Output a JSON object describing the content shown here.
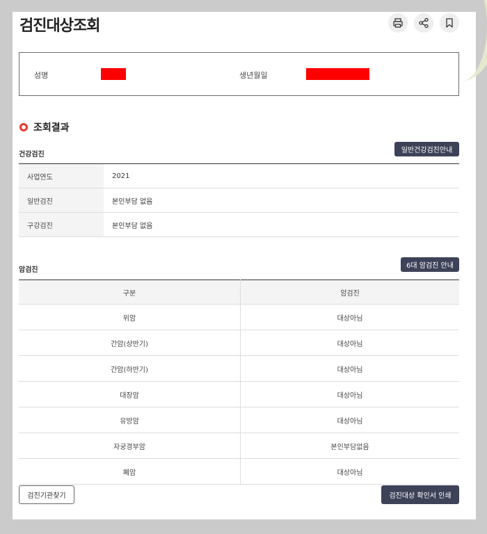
{
  "header": {
    "title": "검진대상조회",
    "icons": [
      "print-icon",
      "share-icon",
      "bookmark-icon"
    ]
  },
  "person": {
    "name_label": "성명",
    "birth_label": "생년월일"
  },
  "results": {
    "title": "조회결과"
  },
  "health_check": {
    "title": "건강검진",
    "guide_button": "일반건강검진안내",
    "rows": [
      {
        "key": "사업연도",
        "value": "2021"
      },
      {
        "key": "일반검진",
        "value": "본인부담 없음"
      },
      {
        "key": "구강검진",
        "value": "본인부담 없음"
      }
    ]
  },
  "cancer_check": {
    "title": "암검진",
    "guide_button": "6대 암검진 안내",
    "headers": [
      "구분",
      "암검진"
    ],
    "rows": [
      {
        "type": "위암",
        "status": "대상아님"
      },
      {
        "type": "간암(상반기)",
        "status": "대상아님"
      },
      {
        "type": "간암(하반기)",
        "status": "대상아님"
      },
      {
        "type": "대장암",
        "status": "대상아님"
      },
      {
        "type": "유방암",
        "status": "대상아님"
      },
      {
        "type": "자궁경부암",
        "status": "본인부담없음"
      },
      {
        "type": "폐암",
        "status": "대상아님"
      }
    ]
  },
  "footer": {
    "find_button": "검진기관찾기",
    "print_button": "검진대상 확인서 인쇄"
  },
  "colors": {
    "accent_red": "#e23b2f",
    "dark_button": "#3e4258",
    "redaction": "#ff0000"
  }
}
